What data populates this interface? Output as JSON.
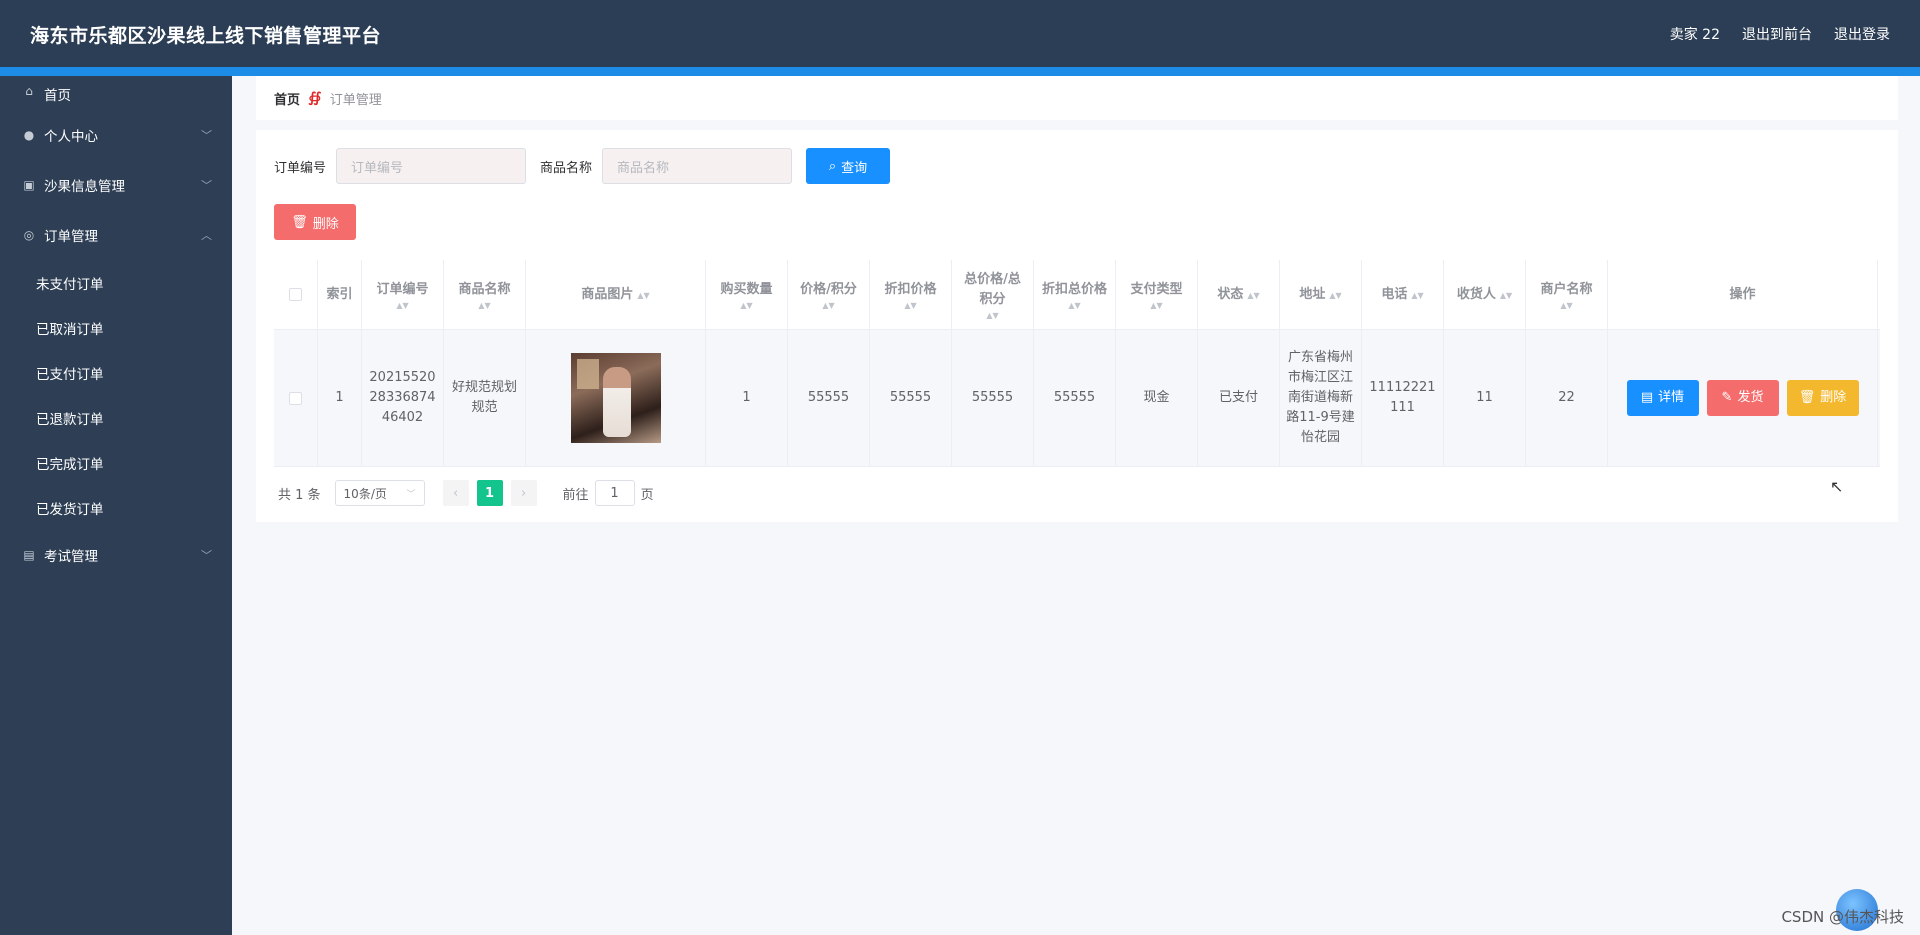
{
  "header": {
    "title": "海东市乐都区沙果线上线下销售管理平台",
    "user": "卖家 22",
    "back_front": "退出到前台",
    "logout": "退出登录"
  },
  "sidebar": {
    "items": [
      {
        "label": "首页",
        "icon": "home-icon"
      },
      {
        "label": "个人中心",
        "icon": "user-icon"
      },
      {
        "label": "沙果信息管理",
        "icon": "chart-icon"
      },
      {
        "label": "订单管理",
        "icon": "order-icon"
      },
      {
        "label": "考试管理",
        "icon": "clipboard-icon"
      }
    ],
    "order_sub": [
      "未支付订单",
      "已取消订单",
      "已支付订单",
      "已退款订单",
      "已完成订单",
      "已发货订单"
    ]
  },
  "breadcrumb": {
    "home": "首页",
    "separator": "∯",
    "current": "订单管理"
  },
  "search": {
    "order_no_label": "订单编号",
    "order_no_placeholder": "订单编号",
    "product_label": "商品名称",
    "product_placeholder": "商品名称",
    "query_label": "查询"
  },
  "toolbar": {
    "delete_label": "删除"
  },
  "table": {
    "headers": [
      "索引",
      "订单编号",
      "商品名称",
      "商品图片",
      "购买数量",
      "价格/积分",
      "折扣价格",
      "总价格/总积分",
      "折扣总价格",
      "支付类型",
      "状态",
      "地址",
      "电话",
      "收货人",
      "商户名称",
      "操作"
    ],
    "rows": [
      {
        "index": "1",
        "order_no": "202155202833687446402",
        "product": "好规范规划规范",
        "qty": "1",
        "price": "55555",
        "discount_price": "55555",
        "total": "55555",
        "discount_total": "55555",
        "pay_type": "现金",
        "status": "已支付",
        "address": "广东省梅州市梅江区江南街道梅新路11-9号建怡花园",
        "phone": "11112221111",
        "receiver": "11",
        "merchant": "22"
      }
    ],
    "ops": {
      "detail": "详情",
      "ship": "发货",
      "delete": "删除"
    }
  },
  "pagination": {
    "total": "共 1 条",
    "page_size": "10条/页",
    "current_page": "1",
    "goto_prefix": "前往",
    "goto_value": "1",
    "goto_suffix": "页"
  },
  "watermark": "CSDN @伟杰科技"
}
